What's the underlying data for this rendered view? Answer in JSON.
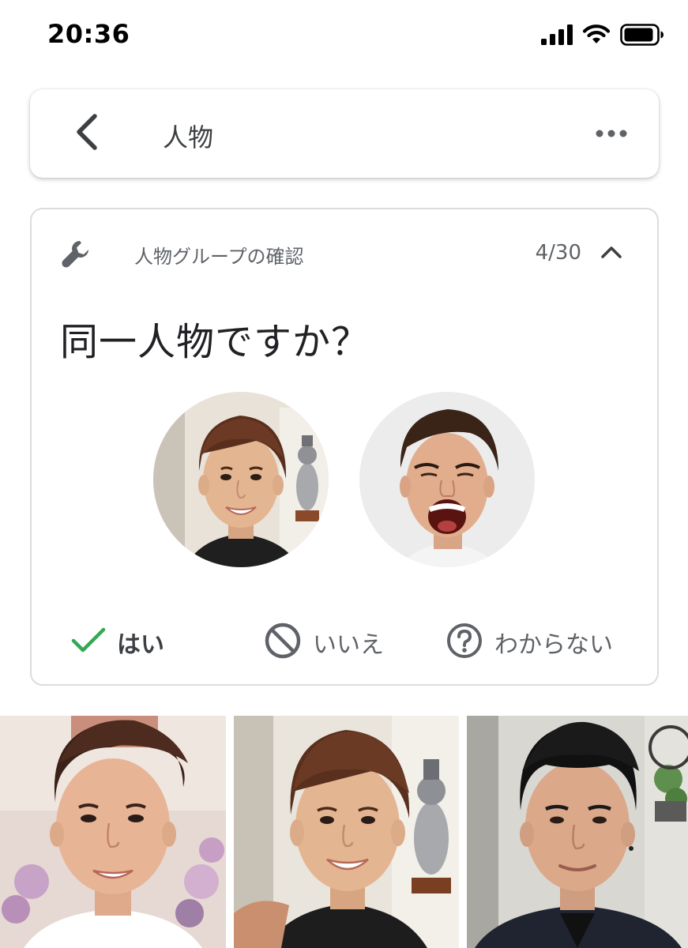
{
  "status_bar": {
    "time": "20:36",
    "icons": [
      "cellular-signal-icon",
      "wifi-icon",
      "battery-icon"
    ]
  },
  "app_bar": {
    "title": "人物",
    "back_icon": "chevron-left-icon",
    "more_icon": "more-horizontal-icon"
  },
  "review_card": {
    "icon": "wrench-icon",
    "label": "人物グループの確認",
    "counter": "4/30",
    "collapse_icon": "chevron-up-icon",
    "question": "同一人物ですか？",
    "faces": [
      {
        "name": "face-photo-1",
        "description_icon": "person-face"
      },
      {
        "name": "face-photo-2",
        "description_icon": "person-face"
      }
    ],
    "answers": {
      "yes": {
        "label": "はい",
        "icon": "check-icon"
      },
      "no": {
        "label": "いいえ",
        "icon": "block-icon"
      },
      "unsure": {
        "label": "わからない",
        "icon": "question-circle-icon"
      }
    }
  },
  "colors": {
    "accent_green": "#34a853",
    "icon_gray": "#5f6368",
    "border": "#dadce0"
  }
}
